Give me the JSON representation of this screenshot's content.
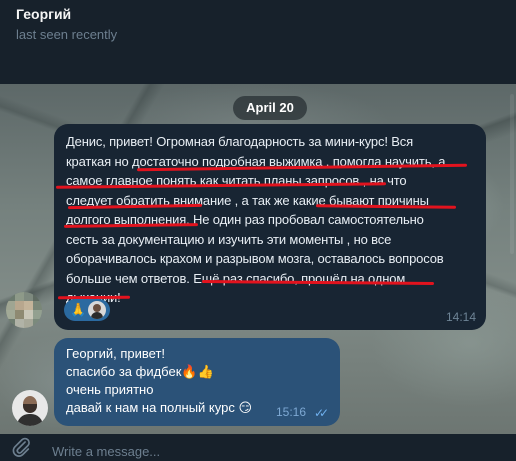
{
  "header": {
    "contact_name": "Георгий",
    "status": "last seen recently"
  },
  "chat": {
    "date_separator": "April 20",
    "incoming": {
      "lines": [
        "Денис, привет! Огромная благодарность за мини-курс! Вся",
        "краткая но достаточно подробная выжимка , помогла научить, а",
        "самое главное  понять  как читать планы запросов , на что",
        "следует обратить внимание , а так же какие бывают причины",
        "долгого выполнения. Не один раз пробовал самостоятельно",
        "сесть за документацию и изучить эти моменты , но все",
        "оборачивалось крахом и разрывом мозга, оставалось вопросов",
        "больше чем ответов. Ещё раз спасибо, прошёл на одном",
        "дыхании!"
      ],
      "reaction_emoji": "🙏",
      "time": "14:14",
      "underline_color": "#e2131e"
    },
    "outgoing": {
      "lines": [
        "Георгий, привет!",
        "спасибо за фидбек🔥👍",
        "очень приятно",
        "давай к нам на полный курс 😏"
      ],
      "time": "15:16",
      "status_icon": "double-check-icon"
    }
  },
  "composer": {
    "placeholder": "Write a message...",
    "attach_icon": "paperclip-icon"
  },
  "colors": {
    "header_bg": "#17212b",
    "incoming_bubble": "#182533",
    "outgoing_bubble": "#2b5278",
    "accent": "#6fb0ee",
    "reaction_bg": "#2b6aa0"
  }
}
